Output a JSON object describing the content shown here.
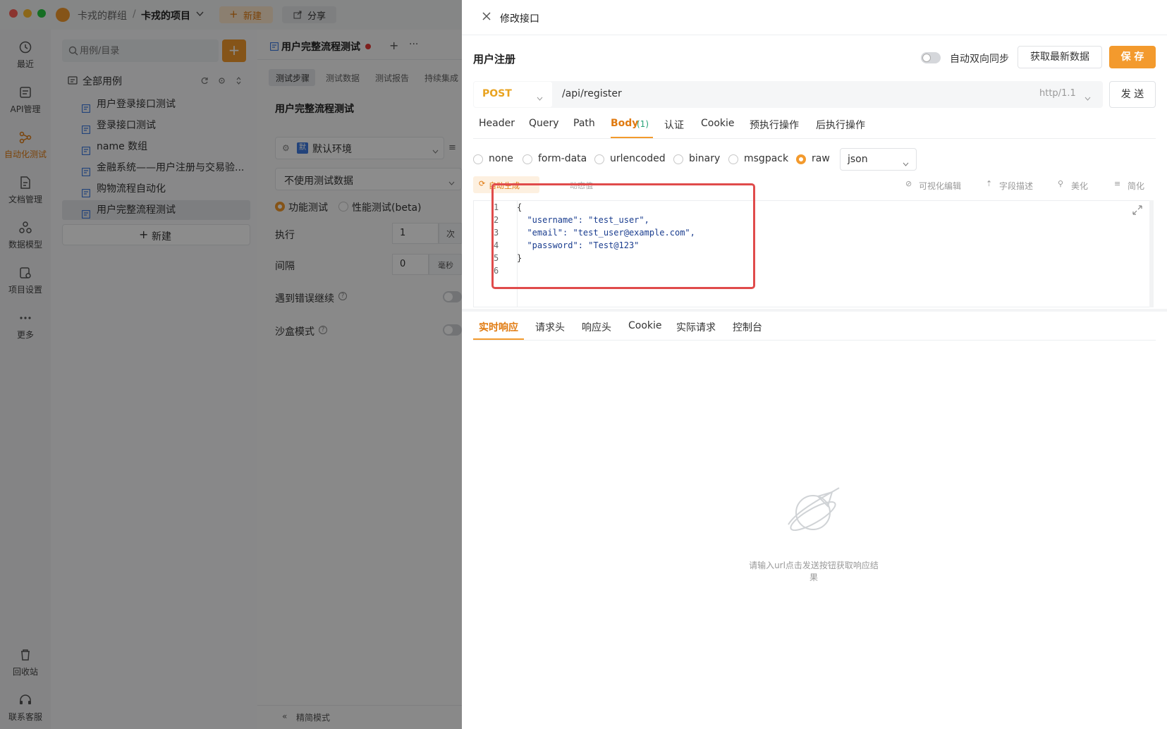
{
  "titlebar": {
    "group": "卡戎的群组",
    "separator": "/",
    "project": "卡戎的项目",
    "new_label": "新建",
    "share_label": "分享"
  },
  "rail": {
    "items": [
      {
        "label": "最近",
        "icon": "clock-icon"
      },
      {
        "label": "API管理",
        "icon": "api-icon"
      },
      {
        "label": "自动化测试",
        "icon": "automation-icon",
        "active": true
      },
      {
        "label": "文档管理",
        "icon": "document-icon"
      },
      {
        "label": "数据模型",
        "icon": "data-model-icon"
      },
      {
        "label": "项目设置",
        "icon": "project-settings-icon"
      },
      {
        "label": "更多",
        "icon": "more-icon"
      }
    ],
    "bottom": [
      {
        "label": "回收站",
        "icon": "trash-icon"
      },
      {
        "label": "联系客服",
        "icon": "headset-icon"
      }
    ]
  },
  "tree": {
    "search_placeholder": "用例/目录",
    "root_label": "全部用例",
    "items": [
      "用户登录接口测试",
      "登录接口测试",
      "name 数组",
      "金融系统——用户注册与交易验...",
      "购物流程自动化",
      "用户完整流程测试"
    ],
    "new_label": "新建"
  },
  "mid": {
    "tab_title": "用户完整流程测试",
    "subtabs": [
      "测试步骤",
      "测试数据",
      "测试报告",
      "持续集成"
    ],
    "heading": "用户完整流程测试",
    "env_badge": "默",
    "env_label": "默认环境",
    "testdata_label": "不使用测试数据",
    "mode_functional": "功能测试",
    "mode_performance": "性能测试(beta)",
    "exec_label": "执行",
    "exec_value": "1",
    "exec_unit": "次",
    "interval_label": "间隔",
    "interval_value": "0",
    "interval_unit": "毫秒",
    "continue_on_error": "遇到错误继续",
    "sandbox_label": "沙盒模式",
    "footer": "精简模式"
  },
  "panel": {
    "title": "修改接口",
    "api_name": "用户注册",
    "sync_label": "自动双向同步",
    "fetch_label": "获取最新数据",
    "save_label": "保 存",
    "method": "POST",
    "url": "/api/register",
    "protocol": "http/1.1",
    "send_label": "发 送",
    "tabs": [
      {
        "label": "Header"
      },
      {
        "label": "Query"
      },
      {
        "label": "Path"
      },
      {
        "label": "Body",
        "count": "(1)",
        "active": true
      },
      {
        "label": "认证"
      },
      {
        "label": "Cookie"
      },
      {
        "label": "预执行操作"
      },
      {
        "label": "后执行操作"
      }
    ],
    "body_types": [
      "none",
      "form-data",
      "urlencoded",
      "binary",
      "msgpack",
      "raw"
    ],
    "body_type_selected": "raw",
    "format": "json",
    "tools": {
      "auto_generate": "自动生成",
      "dynamic_value": "动态值",
      "visual_edit": "可视化编辑",
      "field_desc": "字段描述",
      "beautify": "美化",
      "simplify": "简化"
    },
    "code_lines": [
      "{",
      "  \"username\": \"test_user\",",
      "  \"email\": \"test_user@example.com\",",
      "  \"password\": \"Test@123\"",
      "}",
      ""
    ],
    "response_tabs": [
      "实时响应",
      "请求头",
      "响应头",
      "Cookie",
      "实际请求",
      "控制台"
    ],
    "empty_text": "请输入url点击发送按钮获取响应结果"
  },
  "colors": {
    "accent": "#f39a2d",
    "highlight_box": "#e04b4b",
    "json_string": "#1a3d8f"
  }
}
